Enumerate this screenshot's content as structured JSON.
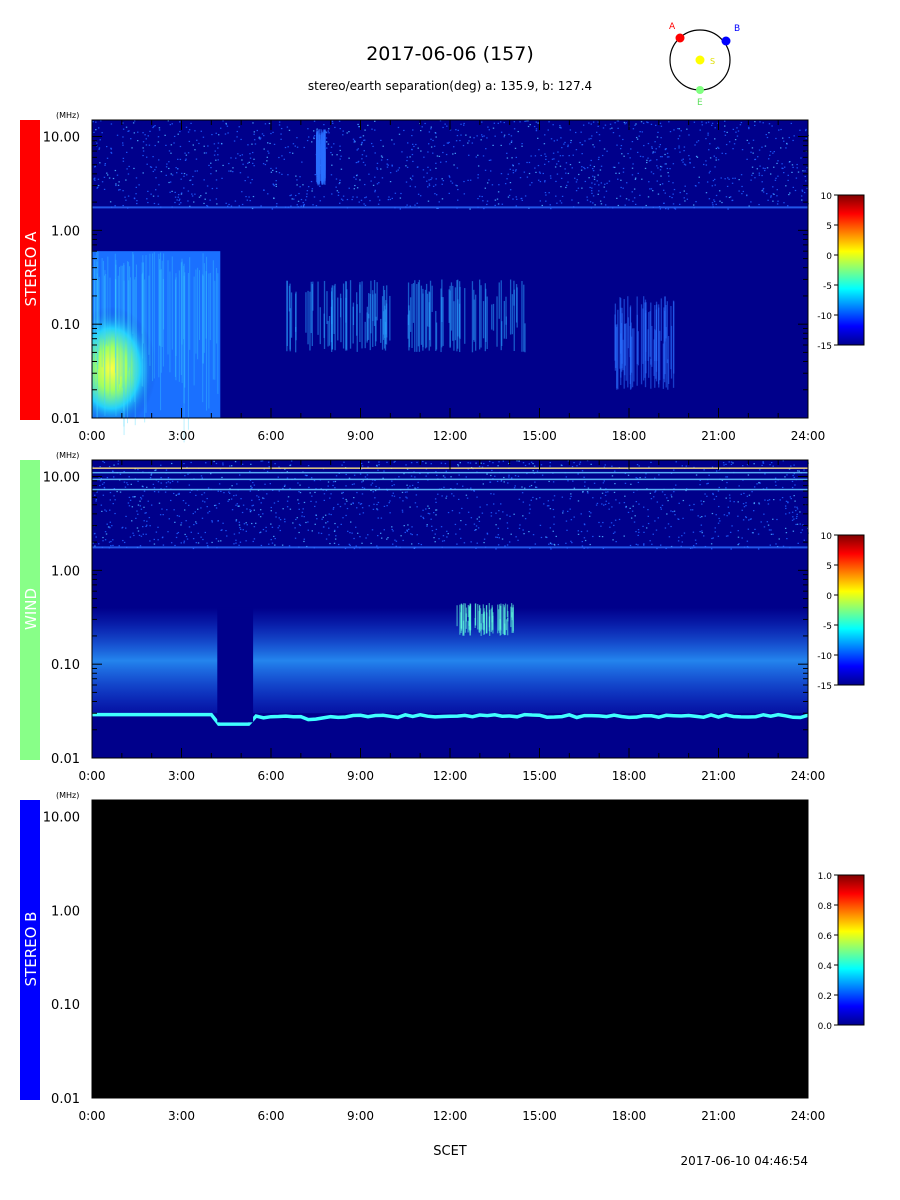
{
  "header": {
    "title": "2017-06-06 (157)",
    "subtitle": "stereo/earth separation(deg) a: 135.9, b: 127.4"
  },
  "orbit_diagram": {
    "labels": {
      "a": "A",
      "b": "B",
      "sun": "S",
      "earth": "E"
    },
    "colors": {
      "a": "#ff0000",
      "b": "#0000ff",
      "sun": "#ffff00",
      "earth": "#80ff80"
    }
  },
  "footer": {
    "xlabel": "SCET",
    "timestamp": "2017-06-10 04:46:54"
  },
  "colors": {
    "stereo_a": "#ff0000",
    "wind": "#88ff88",
    "stereo_b": "#0000ff",
    "background_dark": "#00008b",
    "empty_panel": "#000000"
  },
  "chart_data": [
    {
      "type": "heatmap",
      "panel_label": "STEREO A",
      "unit_label": "(MHz)",
      "ylabel_ticks": [
        "10.00",
        "1.00",
        "0.10",
        "0.01"
      ],
      "y_scale": "log",
      "ylim": [
        0.01,
        15
      ],
      "xlim": [
        "0:00",
        "24:00"
      ],
      "x_ticks": [
        "0:00",
        "3:00",
        "6:00",
        "9:00",
        "12:00",
        "15:00",
        "18:00",
        "21:00",
        "24:00"
      ],
      "colorbar": {
        "range": [
          -15,
          10
        ],
        "ticks": [
          "10",
          "5",
          "0",
          "-5",
          "-10",
          "-15"
        ]
      },
      "features": [
        {
          "name": "strong low-frequency emission",
          "x_hours": [
            0,
            4.3
          ],
          "freq_mhz": [
            0.01,
            0.6
          ],
          "level": "high"
        },
        {
          "name": "emission band",
          "x_hours": [
            6.5,
            10
          ],
          "freq_mhz": [
            0.05,
            0.3
          ],
          "level": "medium"
        },
        {
          "name": "emission band",
          "x_hours": [
            10.5,
            14.5
          ],
          "freq_mhz": [
            0.05,
            0.3
          ],
          "level": "medium"
        },
        {
          "name": "weak emission",
          "x_hours": [
            17.5,
            19.5
          ],
          "freq_mhz": [
            0.02,
            0.2
          ],
          "level": "low"
        },
        {
          "name": "type III burst",
          "x_hours": [
            7.5,
            7.8
          ],
          "freq_mhz": [
            3,
            12
          ],
          "level": "low"
        }
      ]
    },
    {
      "type": "heatmap",
      "panel_label": "WIND",
      "unit_label": "(MHz)",
      "ylabel_ticks": [
        "10.00",
        "1.00",
        "0.10",
        "0.01"
      ],
      "y_scale": "log",
      "ylim": [
        0.01,
        15
      ],
      "xlim": [
        "0:00",
        "24:00"
      ],
      "x_ticks": [
        "0:00",
        "3:00",
        "6:00",
        "9:00",
        "12:00",
        "15:00",
        "18:00",
        "21:00",
        "24:00"
      ],
      "colorbar": {
        "range": [
          -15,
          10
        ],
        "ticks": [
          "10",
          "5",
          "0",
          "-5",
          "-10",
          "-15"
        ]
      },
      "features": [
        {
          "name": "plasma line",
          "x_hours": [
            0,
            24
          ],
          "freq_mhz": [
            0.025,
            0.03
          ],
          "level": "high"
        },
        {
          "name": "burst",
          "x_hours": [
            12.2,
            14.2
          ],
          "freq_mhz": [
            0.2,
            0.45
          ],
          "level": "high"
        },
        {
          "name": "interference lines",
          "x_hours": [
            0,
            24
          ],
          "freq_mhz": [
            6,
            13
          ],
          "level": "medium"
        }
      ]
    },
    {
      "type": "heatmap",
      "panel_label": "STEREO B",
      "unit_label": "(MHz)",
      "ylabel_ticks": [
        "10.00",
        "1.00",
        "0.10",
        "0.01"
      ],
      "y_scale": "log",
      "ylim": [
        0.01,
        15
      ],
      "xlim": [
        "0:00",
        "24:00"
      ],
      "x_ticks": [
        "0:00",
        "3:00",
        "6:00",
        "9:00",
        "12:00",
        "15:00",
        "18:00",
        "21:00",
        "24:00"
      ],
      "colorbar": {
        "range": [
          0.0,
          1.0
        ],
        "ticks": [
          "1.0",
          "0.8",
          "0.6",
          "0.4",
          "0.2",
          "0.0"
        ]
      },
      "features": []
    }
  ]
}
